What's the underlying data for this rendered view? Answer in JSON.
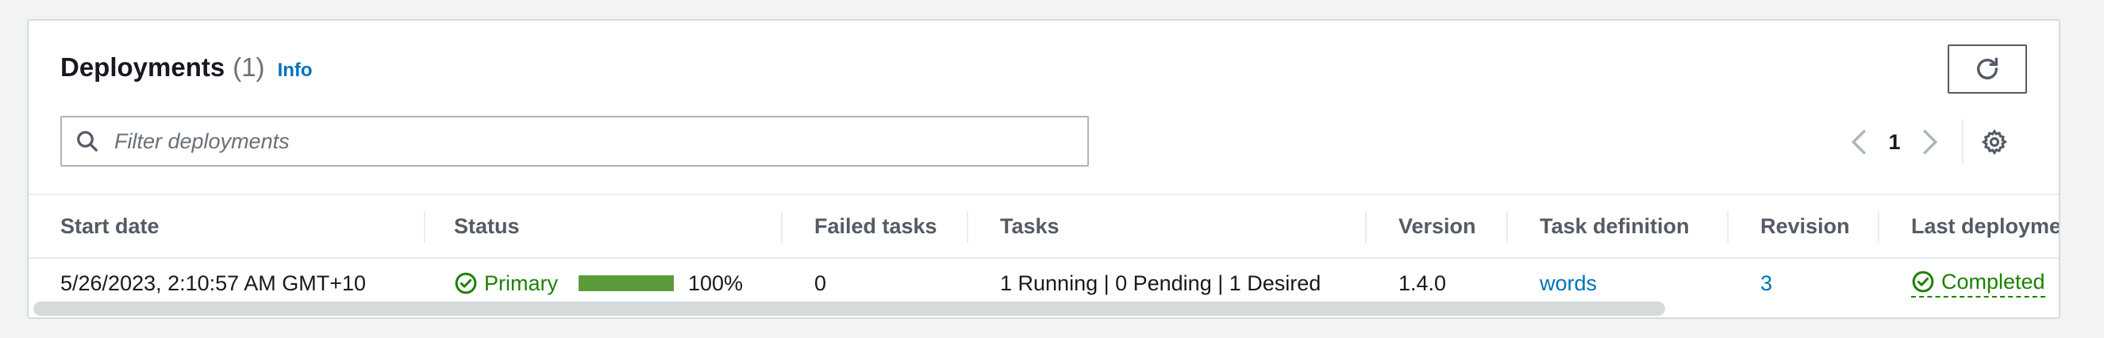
{
  "header": {
    "title": "Deployments",
    "count": "(1)",
    "info": "Info"
  },
  "search": {
    "placeholder": "Filter deployments",
    "value": ""
  },
  "pagination": {
    "page": "1"
  },
  "table": {
    "columns": [
      "Start date",
      "Status",
      "Failed tasks",
      "Tasks",
      "Version",
      "Task definition",
      "Revision",
      "Last deployme"
    ],
    "rows": [
      {
        "start_date": "5/26/2023, 2:10:57 AM GMT+10",
        "status": "Primary",
        "progress_percent": 100,
        "progress_label": "100%",
        "failed_tasks": "0",
        "tasks": "1 Running | 0 Pending | 1 Desired",
        "version": "1.4.0",
        "task_definition": "words",
        "revision": "3",
        "last_deployment": "Completed"
      }
    ]
  },
  "colors": {
    "link": "#0073bb",
    "success": "#1d8102",
    "progress": "#5c9b3b"
  },
  "icons": [
    "refresh-icon",
    "search-icon",
    "chevron-left-icon",
    "chevron-right-icon",
    "gear-icon",
    "status-check-icon",
    "completed-check-icon"
  ]
}
